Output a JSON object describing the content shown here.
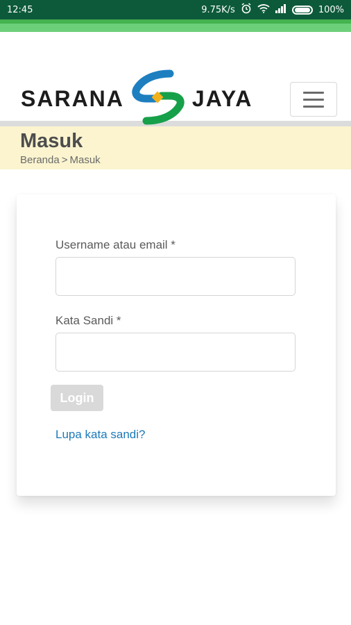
{
  "status_bar": {
    "time": "12:45",
    "speed": "9.75K/s",
    "battery": "100%"
  },
  "brand": {
    "left": "SARANA",
    "right": "JAYA"
  },
  "breadcrumb": {
    "title": "Masuk",
    "home": "Beranda",
    "separator": ">",
    "current": "Masuk"
  },
  "form": {
    "username_label": "Username atau email *",
    "username_value": "",
    "password_label": "Kata Sandi *",
    "password_value": "",
    "login_label": "Login",
    "forgot_label": "Lupa kata sandi?"
  },
  "icons": [
    "alarm-icon",
    "wifi-icon",
    "signal-icon",
    "battery-icon",
    "menu-icon"
  ],
  "colors": {
    "status_bar": "#0d5a3a",
    "accent_green": "#45b34f",
    "breadcrumb_band": "#fbf4cf",
    "link": "#1b79b9"
  }
}
